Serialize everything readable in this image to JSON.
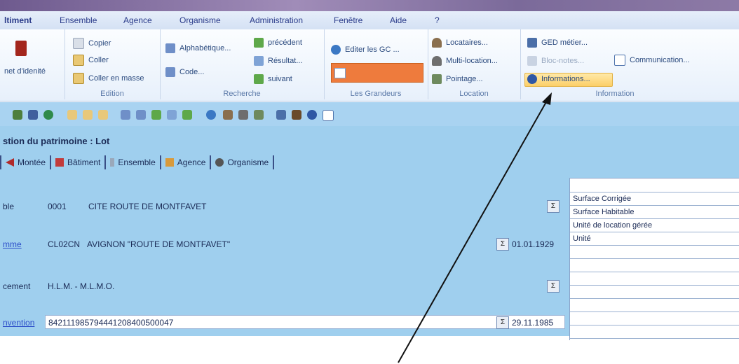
{
  "menu": {
    "items": [
      "ltiment",
      "Ensemble",
      "Agence",
      "Organisme",
      "Administration",
      "Fenêtre",
      "Aide",
      "?"
    ]
  },
  "ribbon": {
    "left_group": {
      "label": "net d'idenité"
    },
    "edition": {
      "title": "Edition",
      "copier": "Copier",
      "coller": "Coller",
      "coller_masse": "Coller en masse"
    },
    "recherche": {
      "title": "Recherche",
      "alphabetique": "Alphabétique...",
      "code": "Code...",
      "precedent": "précédent",
      "resultat": "Résultat...",
      "suivant": "suivant"
    },
    "grandeurs": {
      "title": "Les Grandeurs",
      "editer": "Editer les GC ..."
    },
    "location": {
      "title": "Location",
      "locataires": "Locataires...",
      "multi": "Multi-location...",
      "pointage": "Pointage..."
    },
    "information": {
      "title": "Information",
      "ged": "GED métier...",
      "bloc": "Bloc-notes...",
      "informations": "Informations...",
      "communication": "Communication..."
    }
  },
  "page": {
    "title": "stion du patrimoine : Lot",
    "tabs": [
      "Montée",
      "Bâtiment",
      "Ensemble",
      "Agence",
      "Organisme"
    ]
  },
  "fields": {
    "ensemble": {
      "label": "ble",
      "code": "0001",
      "name": "CITE ROUTE DE MONTFAVET"
    },
    "programme": {
      "label": "mme",
      "code": "CL02CN",
      "name": "AVIGNON \"ROUTE DE MONTFAVET\"",
      "date": "01.01.1929"
    },
    "financement": {
      "label": "cement",
      "value": "H.L.M. - M.L.M.O."
    },
    "convention": {
      "label": "nvention",
      "value": "842111985794441208400500047",
      "date": "29.11.1985"
    }
  },
  "list": {
    "items": [
      "Surface Corrigée",
      "Surface Habitable",
      "Unité de location gérée",
      "Unité"
    ]
  },
  "colors": {
    "content_bg": "#9fcfee",
    "toolbar_bg": "#a9d3f1",
    "highlight": "#fccf68",
    "orange": "#ee7b3d"
  }
}
